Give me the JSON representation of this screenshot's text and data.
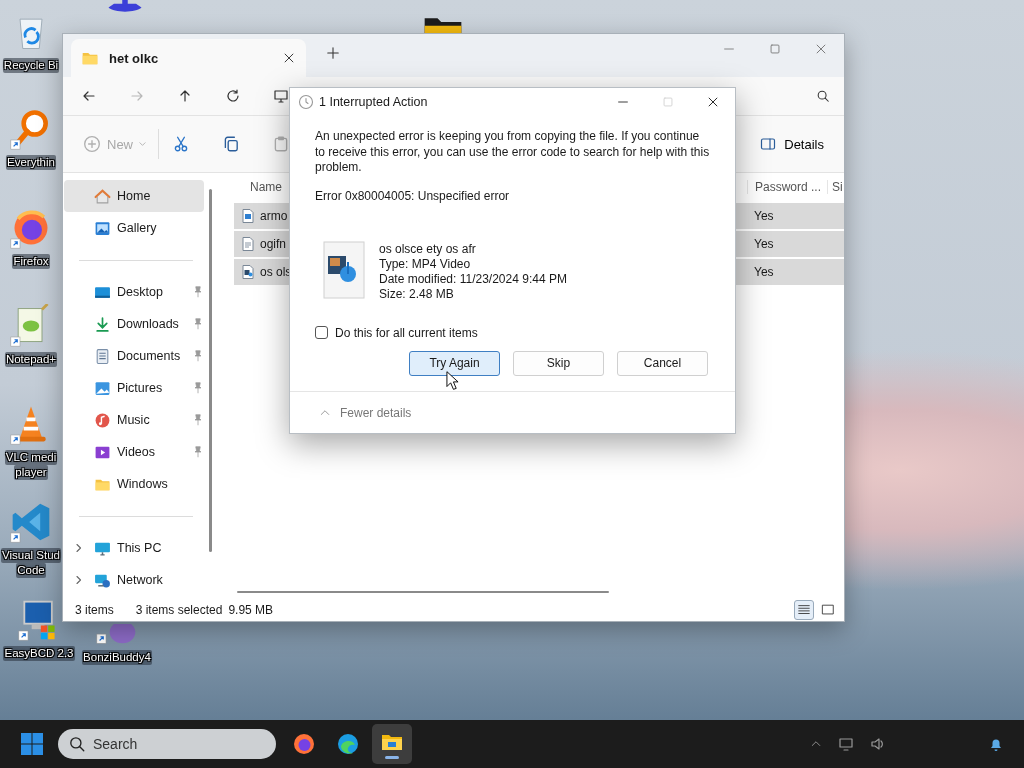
{
  "desktop_icons": [
    {
      "kind": "recycle-bin",
      "lines": [
        "Recycle Bi"
      ]
    },
    {
      "kind": "figure"
    },
    {
      "kind": "folder"
    },
    {
      "kind": "everything",
      "lines": [
        "Everythin"
      ]
    },
    {
      "kind": "firefox",
      "lines": [
        "Firefox"
      ]
    },
    {
      "kind": "notepad",
      "lines": [
        "Notepad+"
      ]
    },
    {
      "kind": "vlc",
      "lines": [
        "VLC medi",
        "player"
      ]
    },
    {
      "kind": "vscode",
      "lines": [
        "Visual Stud",
        "Code"
      ]
    },
    {
      "kind": "easybcd",
      "lines": [
        "EasyBCD 2.3"
      ]
    },
    {
      "kind": "bonzi",
      "lines": [
        "BonziBuddy4"
      ]
    }
  ],
  "explorer": {
    "tabs": [
      {
        "title": "het olkc",
        "selected": true
      }
    ],
    "window_controls": [
      {
        "kind": "minimize"
      },
      {
        "kind": "maximize"
      },
      {
        "kind": "close"
      }
    ],
    "nav": [
      {
        "kind": "back",
        "disabled": false
      },
      {
        "kind": "forward",
        "disabled": true
      },
      {
        "kind": "up",
        "disabled": false
      },
      {
        "kind": "refresh",
        "disabled": false
      },
      {
        "kind": "computer",
        "disabled": false
      }
    ],
    "commands": [
      {
        "kind": "new",
        "label": "New",
        "disabled": true
      },
      {
        "kind": "cut",
        "disabled": false
      },
      {
        "kind": "copy",
        "disabled": false
      },
      {
        "kind": "paste",
        "disabled": true
      }
    ],
    "details_button": "Details",
    "sidebar": [
      [
        {
          "kind": "home",
          "label": "Home",
          "pinned": false,
          "selected": true
        },
        {
          "kind": "gallery",
          "label": "Gallery",
          "pinned": false,
          "selected": false
        }
      ],
      [
        {
          "kind": "desktop",
          "label": "Desktop",
          "pinned": true,
          "selected": false
        },
        {
          "kind": "downloads",
          "label": "Downloads",
          "pinned": true,
          "selected": false
        },
        {
          "kind": "documents",
          "label": "Documents",
          "pinned": true,
          "selected": false
        },
        {
          "kind": "pictures",
          "label": "Pictures",
          "pinned": true,
          "selected": false
        },
        {
          "kind": "music",
          "label": "Music",
          "pinned": true,
          "selected": false
        },
        {
          "kind": "videos",
          "label": "Videos",
          "pinned": true,
          "selected": false
        },
        {
          "kind": "folder",
          "label": "Windows",
          "pinned": false,
          "selected": false
        }
      ],
      [
        {
          "kind": "pc",
          "label": "This PC",
          "pinned": false,
          "expanded": false,
          "selected": false
        },
        {
          "kind": "network",
          "label": "Network",
          "pinned": false,
          "expanded": false,
          "selected": false
        }
      ]
    ],
    "columns": [
      {
        "label": "Name"
      },
      {
        "label": "Password ..."
      },
      {
        "label": "Si"
      }
    ],
    "rows": [
      {
        "kind": "image",
        "name": "armo",
        "password": "Yes",
        "selected": true
      },
      {
        "kind": "text",
        "name": "ogifn",
        "password": "Yes",
        "selected": true
      },
      {
        "kind": "video",
        "name": "os ols",
        "password": "Yes",
        "selected": true
      }
    ],
    "status_bar": {
      "item_count": "3 items",
      "selection": "3 items selected",
      "size": "9.95 MB"
    },
    "views": [
      {
        "kind": "details",
        "selected": true
      },
      {
        "kind": "tiles",
        "selected": false
      }
    ]
  },
  "dialog": {
    "title": "1 Interrupted Action",
    "controls": [
      {
        "kind": "minimize",
        "disabled": false
      },
      {
        "kind": "maximize",
        "disabled": true
      },
      {
        "kind": "close",
        "disabled": false
      }
    ],
    "message": "An unexpected error is keeping you from copying the file. If you continue to receive this error, you can use the error code to search for help with this problem.",
    "error": "Error 0x80004005: Unspecified error",
    "file": {
      "kind": "video",
      "details": [
        "os olsce ety os afr",
        "Type: MP4 Video",
        "Date modified: 11/23/2024 9:44 PM",
        "Size: 2.48 MB"
      ]
    },
    "checkbox": {
      "label": "Do this for all current items",
      "checked": false
    },
    "buttons": [
      {
        "label": "Try Again",
        "focused": true
      },
      {
        "label": "Skip",
        "focused": false
      },
      {
        "label": "Cancel",
        "focused": false
      }
    ],
    "details_toggle": {
      "label": "Fewer details",
      "expanded": true
    }
  },
  "taskbar": {
    "search_placeholder": "Search",
    "apps": [
      {
        "kind": "firefox",
        "active": false
      },
      {
        "kind": "edge",
        "active": false
      },
      {
        "kind": "explorer",
        "active": true
      }
    ]
  }
}
